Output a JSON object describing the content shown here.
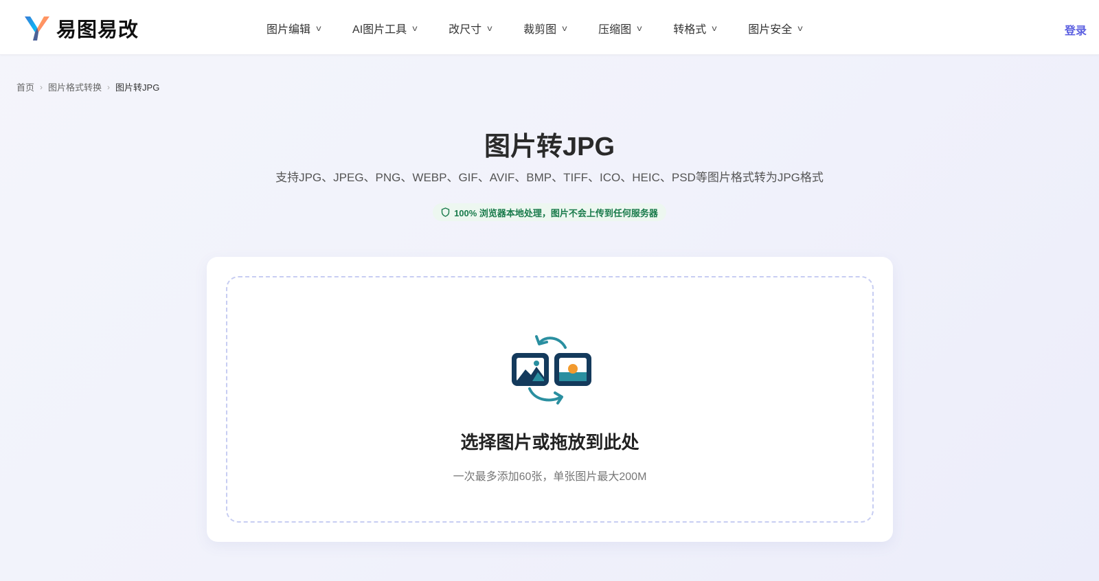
{
  "brand": {
    "name": "易图易改",
    "logo_icon": "y-logo-icon"
  },
  "nav": {
    "items": [
      {
        "label": "图片编辑",
        "chevron": "v"
      },
      {
        "label": "AI图片工具",
        "chevron": "v"
      },
      {
        "label": "改尺寸",
        "chevron": "v"
      },
      {
        "label": "裁剪图",
        "chevron": "v"
      },
      {
        "label": "压缩图",
        "chevron": "v"
      },
      {
        "label": "转格式",
        "chevron": "v"
      },
      {
        "label": "图片安全",
        "chevron": "v"
      }
    ],
    "login_label": "登录"
  },
  "breadcrumb": {
    "items": [
      "首页",
      "图片格式转换",
      "图片转JPG"
    ],
    "separator": "›"
  },
  "page": {
    "title": "图片转JPG",
    "subtitle": "支持JPG、JPEG、PNG、WEBP、GIF、AVIF、BMP、TIFF、ICO、HEIC、PSD等图片格式转为JPG格式",
    "privacy_badge": "100% 浏览器本地处理，图片不会上传到任何服务器"
  },
  "upload": {
    "title": "选择图片或拖放到此处",
    "hint": "一次最多添加60张，单张图片最大200M",
    "icon": "image-convert-icon"
  },
  "colors": {
    "accent": "#5b5fe0",
    "badge_text": "#187a4a",
    "badge_bg": "#edf7f0",
    "icon_navy": "#143a5c",
    "icon_teal": "#2a8fa0",
    "icon_orange": "#f29a2e",
    "dropzone_border": "#c7cdf2"
  }
}
